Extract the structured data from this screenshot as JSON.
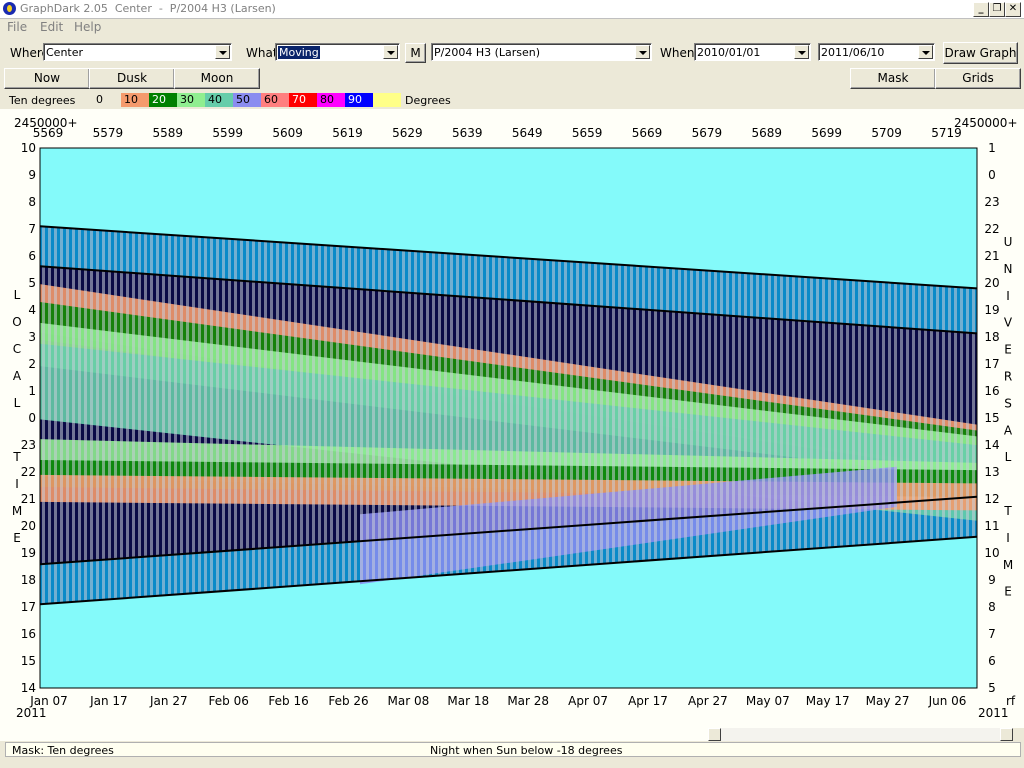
{
  "window": {
    "title": "GraphDark 2.05  Center  -  P/2004 H3 (Larsen)",
    "min_glyph": "_",
    "max_glyph": "❐",
    "close_glyph": "✕"
  },
  "menu": [
    {
      "label": "File",
      "key": "F"
    },
    {
      "label": "Edit",
      "key": "E"
    },
    {
      "label": "Help",
      "key": "H"
    }
  ],
  "toolbar": {
    "where_label": "Where",
    "where_value": "Center",
    "what_label": "What",
    "what_value": "Moving",
    "m_button": "M",
    "object_value": "P/2004 H3 (Larsen)",
    "when_label": "When",
    "start_date": "2010/01/01",
    "end_date": "2011/06/10",
    "draw_button": "Draw Graph"
  },
  "buttons": {
    "now": "Now",
    "dusk": "Dusk",
    "moon": "Moon",
    "mask": "Mask",
    "grids": "Grids"
  },
  "legend": {
    "title": "Ten degrees",
    "unit": "Degrees",
    "items": [
      {
        "label": "0",
        "color": "#ece9d8"
      },
      {
        "label": "10",
        "color": "#f59a6c"
      },
      {
        "label": "20",
        "color": "#008000"
      },
      {
        "label": "30",
        "color": "#90ee90"
      },
      {
        "label": "40",
        "color": "#66cdaa"
      },
      {
        "label": "50",
        "color": "#8a8cf0"
      },
      {
        "label": "60",
        "color": "#ff7f7f"
      },
      {
        "label": "70",
        "color": "#ff0000"
      },
      {
        "label": "80",
        "color": "#ff00ff"
      },
      {
        "label": "90",
        "color": "#0000ff"
      },
      {
        "label": "",
        "color": "#ffff88"
      }
    ]
  },
  "chart_data": {
    "type": "heatmap",
    "top_axis_prefix": "2450000+",
    "top_axis_prefix_right": "2450000+",
    "jd_ticks": [
      "5569",
      "5579",
      "5589",
      "5599",
      "5609",
      "5619",
      "5629",
      "5639",
      "5649",
      "5659",
      "5669",
      "5679",
      "5689",
      "5699",
      "5709",
      "5719"
    ],
    "date_ticks": [
      "Jan 07",
      "Jan 17",
      "Jan 27",
      "Feb 06",
      "Feb 16",
      "Feb 26",
      "Mar 08",
      "Mar 18",
      "Mar 28",
      "Apr 07",
      "Apr 17",
      "Apr 27",
      "May 07",
      "May 17",
      "May 27",
      "Jun 06"
    ],
    "year_left": "2011",
    "year_right": "2011",
    "right_corner_label": "rf",
    "left_ticks": [
      "10",
      "9",
      "8",
      "7",
      "6",
      "5",
      "4",
      "3",
      "2",
      "1",
      "0",
      "23",
      "22",
      "21",
      "20",
      "19",
      "18",
      "17",
      "16",
      "15",
      "14"
    ],
    "right_ticks": [
      "1",
      "0",
      "23",
      "22",
      "21",
      "20",
      "19",
      "18",
      "17",
      "16",
      "15",
      "14",
      "13",
      "12",
      "11",
      "10",
      "9",
      "8",
      "7",
      "6",
      "5"
    ],
    "left_axis_title": [
      "L",
      "O",
      "C",
      "A",
      "L",
      "",
      "T",
      "I",
      "M",
      "E"
    ],
    "right_axis_title": [
      "U",
      "N",
      "I",
      "V",
      "E",
      "R",
      "S",
      "A",
      "L",
      "",
      "T",
      "I",
      "M",
      "E"
    ],
    "night_bounds": {
      "dusk_local_hour": {
        "start": 7.1,
        "end": 4.8
      },
      "dawn_local_hour": {
        "start": 17.1,
        "end": 19.6
      }
    },
    "twilight_color": "#0a8ac8",
    "night_color": "#0a0a46",
    "moon_color": "#c8cdd8",
    "sky_color": "#84fafa"
  },
  "status": {
    "mask": "Mask:  Ten degrees",
    "note": "Night when Sun below -18 degrees"
  }
}
